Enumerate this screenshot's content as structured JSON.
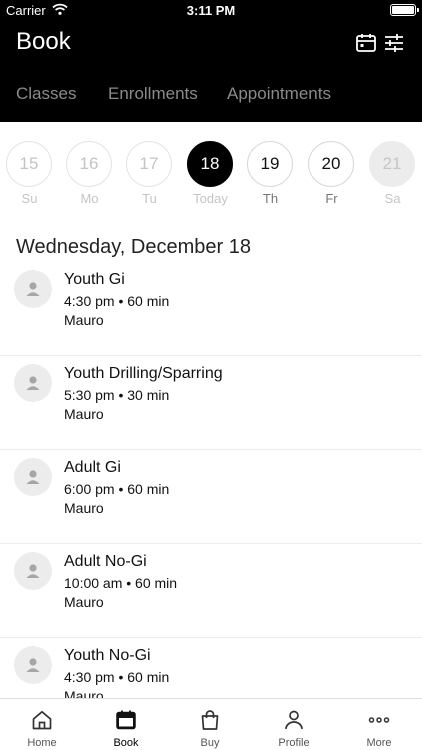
{
  "status_bar": {
    "carrier": "Carrier",
    "time": "3:11 PM"
  },
  "header": {
    "title": "Book",
    "icons": [
      "calendar-icon",
      "filter-sliders-icon"
    ]
  },
  "tabs": [
    {
      "label": "Classes",
      "active": true
    },
    {
      "label": "Enrollments",
      "active": false
    },
    {
      "label": "Appointments",
      "active": false
    }
  ],
  "days": [
    {
      "num": "15",
      "label": "Su",
      "state": "past"
    },
    {
      "num": "16",
      "label": "Mo",
      "state": "past"
    },
    {
      "num": "17",
      "label": "Tu",
      "state": "past"
    },
    {
      "num": "18",
      "label": "Today",
      "state": "selected"
    },
    {
      "num": "19",
      "label": "Th",
      "state": "available"
    },
    {
      "num": "20",
      "label": "Fr",
      "state": "available"
    },
    {
      "num": "21",
      "label": "Sa",
      "state": "disabled"
    }
  ],
  "date_heading": "Wednesday, December 18",
  "classes": [
    {
      "name": "Youth Gi",
      "time": "4:30 pm • 60 min",
      "instructor": "Mauro"
    },
    {
      "name": "Youth Drilling/Sparring",
      "time": "5:30 pm • 30 min",
      "instructor": "Mauro"
    },
    {
      "name": "Adult Gi",
      "time": "6:00 pm • 60 min",
      "instructor": "Mauro"
    },
    {
      "name": "Adult No-Gi",
      "time": "10:00 am • 60 min",
      "instructor": "Mauro"
    },
    {
      "name": "Youth No-Gi",
      "time": "4:30 pm • 60 min",
      "instructor": "Mauro"
    }
  ],
  "tab_bar": [
    {
      "label": "Home",
      "icon": "home-icon",
      "active": false
    },
    {
      "label": "Book",
      "icon": "calendar-icon",
      "active": true
    },
    {
      "label": "Buy",
      "icon": "shopping-bag-icon",
      "active": false
    },
    {
      "label": "Profile",
      "icon": "person-icon",
      "active": false
    },
    {
      "label": "More",
      "icon": "more-dots-icon",
      "active": false
    }
  ],
  "colors": {
    "header_bg": "#000000",
    "accent": "#000000",
    "muted": "#8a8a8a"
  }
}
